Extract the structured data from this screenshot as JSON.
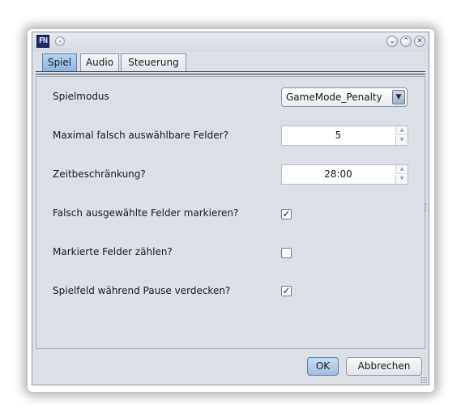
{
  "window": {
    "icon_text": "FN",
    "controls": {
      "minimize": "⌄",
      "maximize": "⌃",
      "close": "✕"
    }
  },
  "tabs": [
    {
      "label": "Spiel",
      "active": true
    },
    {
      "label": "Audio",
      "active": false
    },
    {
      "label": "Steuerung",
      "active": false
    }
  ],
  "settings": {
    "game_mode": {
      "label": "Spielmodus",
      "value": "GameMode_Penalty"
    },
    "max_wrong_fields": {
      "label": "Maximal falsch auswählbare Felder?",
      "value": "5"
    },
    "time_limit": {
      "label": "Zeitbeschränkung?",
      "value": "28:00"
    },
    "mark_wrong_fields": {
      "label": "Falsch ausgewählte Felder markieren?",
      "checked": true
    },
    "count_marked_fields": {
      "label": "Markierte Felder zählen?",
      "checked": false
    },
    "hide_field_on_pause": {
      "label": "Spielfeld während Pause verdecken?",
      "checked": true
    }
  },
  "buttons": {
    "ok": "OK",
    "cancel": "Abbrechen"
  },
  "icons": {
    "combo_arrow": "▼",
    "spin_up": "▲",
    "spin_down": "▼",
    "check": "✓"
  },
  "colors": {
    "window_bg": "#dcdfe6",
    "active_tab": "#a5c5e8",
    "ok_button": "#b3cde9"
  }
}
